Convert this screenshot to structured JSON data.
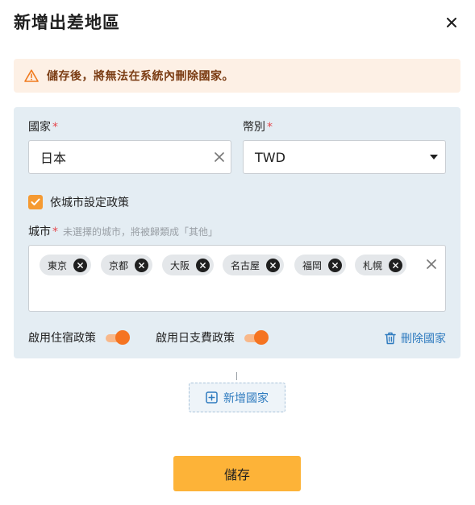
{
  "dialog": {
    "title": "新增出差地區"
  },
  "warning": {
    "text": "儲存後，將無法在系統內刪除國家。",
    "color": "#f07a1e"
  },
  "country_field": {
    "label": "國家",
    "required_mark": "*",
    "value": "日本"
  },
  "currency_field": {
    "label": "幣別",
    "required_mark": "*",
    "value": "TWD"
  },
  "city_policy_checkbox": {
    "label": "依城市設定政策",
    "checked": true
  },
  "city_field": {
    "label": "城市",
    "required_mark": "*",
    "hint": "未選擇的城市，將被歸類成「其他」",
    "tags": [
      "東京",
      "京都",
      "大阪",
      "名古屋",
      "福岡",
      "札幌"
    ]
  },
  "toggles": {
    "lodging_label": "啟用住宿政策",
    "lodging_on": true,
    "allowance_label": "啟用日支費政策",
    "allowance_on": true
  },
  "delete_country_label": "刪除國家",
  "add_country_label": "新增國家",
  "save_label": "儲存",
  "colors": {
    "accent_orange": "#f57421",
    "primary_button": "#fdb338",
    "link_blue": "#2f7bbf",
    "panel_bg": "#e4edf3"
  }
}
